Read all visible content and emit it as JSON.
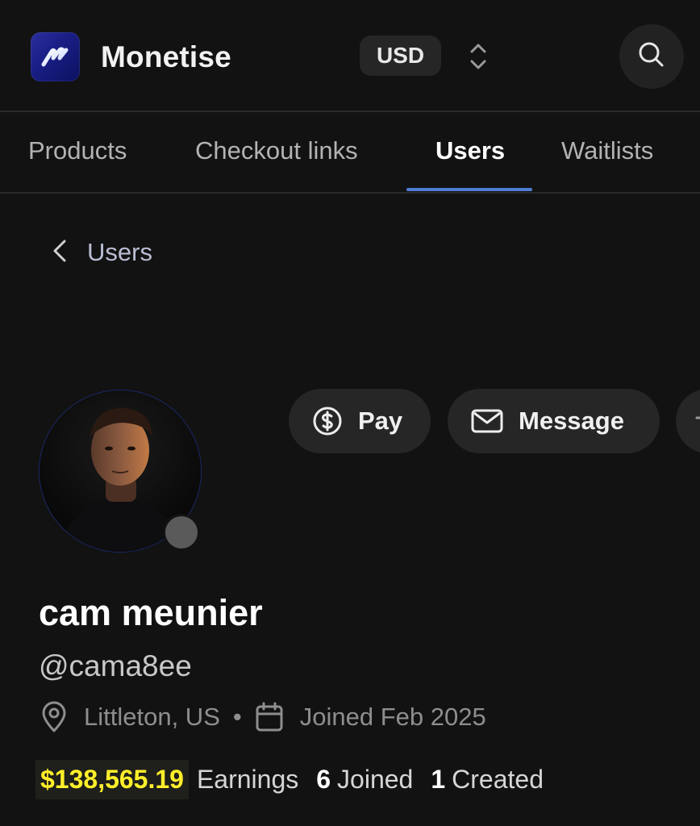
{
  "app": {
    "title": "Monetise",
    "logo_icon": "monetise-logo-icon",
    "accent": "#4f7dd6"
  },
  "header": {
    "currency": "USD",
    "currency_toggle_icon": "chevron-up-down-icon",
    "search_icon": "search-icon"
  },
  "tabs": [
    {
      "label": "Products",
      "active": false
    },
    {
      "label": "Checkout links",
      "active": false
    },
    {
      "label": "Users",
      "active": true
    },
    {
      "label": "Waitlists",
      "active": false
    }
  ],
  "breadcrumb": {
    "back_icon": "chevron-left-icon",
    "label": "Users"
  },
  "profile": {
    "name": "cam meunier",
    "handle": "@cama8ee",
    "location": "Littleton, US",
    "joined": "Joined Feb 2025",
    "status": "offline",
    "actions": {
      "pay": "Pay",
      "message": "Message"
    },
    "stats": {
      "earnings_value": "$138,565.19",
      "earnings_label": "Earnings",
      "joined_count": "6",
      "joined_label": "Joined",
      "created_count": "1",
      "created_label": "Created"
    },
    "highlight_color": "#ffef2a"
  }
}
